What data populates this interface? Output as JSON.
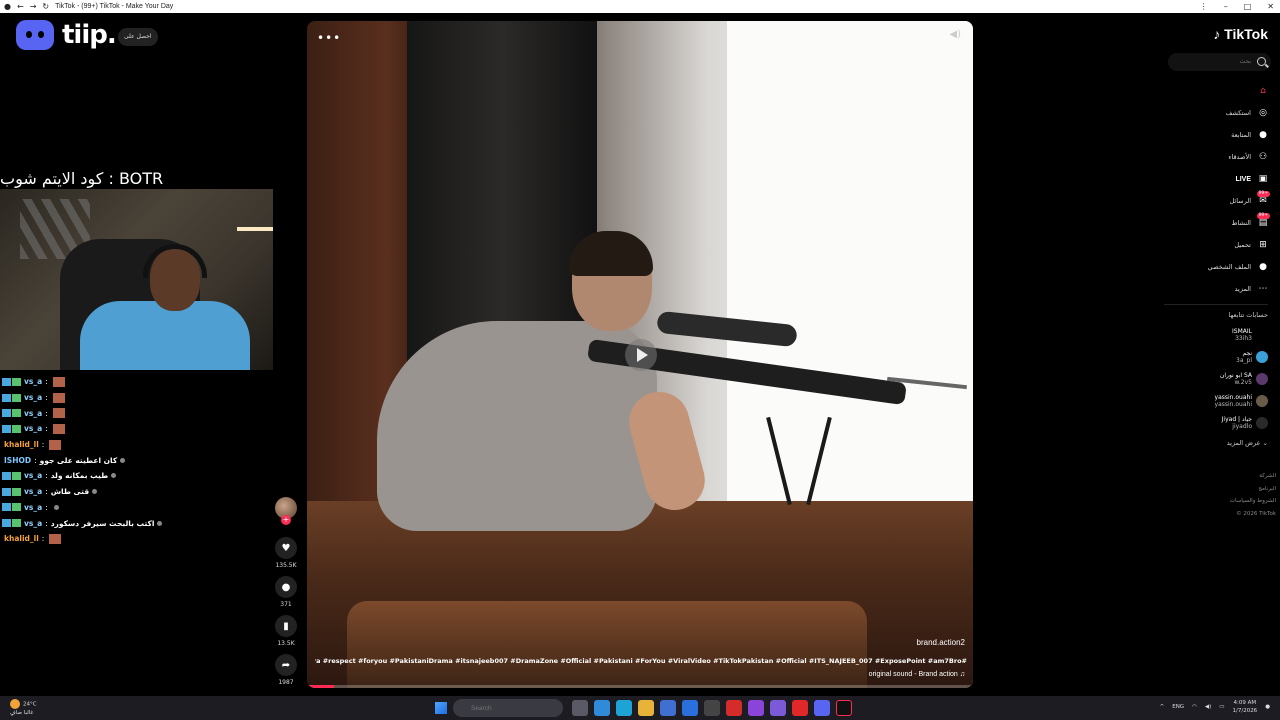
{
  "browser": {
    "tab_title": "TikTok - (99+) TikTok - Make Your Day",
    "nav_icons": [
      "back-icon",
      "forward-icon",
      "reload-icon"
    ]
  },
  "overlay": {
    "tiip_label": "tiip.",
    "get_pill": "احصل على",
    "item_code": "كود الايتم شوب : BOTR"
  },
  "chat": [
    {
      "user": "vs_a",
      "color": "blue",
      "badges": true,
      "message": "",
      "emote": true
    },
    {
      "user": "vs_a",
      "color": "blue",
      "badges": true,
      "message": "",
      "emote": true
    },
    {
      "user": "vs_a",
      "color": "blue",
      "badges": true,
      "message": "",
      "emote": true
    },
    {
      "user": "vs_a",
      "color": "blue",
      "badges": true,
      "message": "",
      "emote": true
    },
    {
      "user": "khalid_ll",
      "color": "orange",
      "badges": false,
      "message": "",
      "emote": true
    },
    {
      "user": "ISHOD",
      "color": "cyan",
      "badges": false,
      "message": "كان اعطيته على جوو",
      "emote": false
    },
    {
      "user": "vs_a",
      "color": "blue",
      "badges": true,
      "message": "طيب بمكانه ولد",
      "emote": false
    },
    {
      "user": "vs_a",
      "color": "blue",
      "badges": true,
      "message": "قتى طاش",
      "emote": false
    },
    {
      "user": "vs_a",
      "color": "blue",
      "badges": true,
      "message": "",
      "emote": false
    },
    {
      "user": "vs_a",
      "color": "blue",
      "badges": true,
      "message": "اكتب بالبحث سيرفر دسكورد",
      "emote": false
    },
    {
      "user": "khalid_ll",
      "color": "orange",
      "badges": false,
      "message": "",
      "emote": true
    }
  ],
  "actions": {
    "likes": "135.5K",
    "comments": "371",
    "saves": "13.5K",
    "shares": "1987"
  },
  "video": {
    "watermark": "brand.action2",
    "caption": "#edit #aura #respect #foryou #PakistaniDrama #itsnajeeb007 #DramaZone #Official #Pakistani #ForYou #ViralVideo #TikTokPakistan #Official #ITS_NAJEEB_007 #ExposePoint #am7Bro... المزيد",
    "sound": "original sound - Brand action",
    "progress": 0.04
  },
  "sidebar": {
    "logo": "TikTok",
    "search_placeholder": "بحث",
    "nav": [
      {
        "label": "",
        "icon": "home-icon",
        "active": true,
        "badge": ""
      },
      {
        "label": "استكشف",
        "icon": "compass-icon",
        "active": false,
        "badge": ""
      },
      {
        "label": "المتابعة",
        "icon": "following-avatar-icon",
        "active": false,
        "badge": ""
      },
      {
        "label": "الأصدقاء",
        "icon": "friends-icon",
        "active": false,
        "badge": ""
      },
      {
        "label": "LIVE",
        "icon": "live-icon",
        "active": false,
        "badge": ""
      },
      {
        "label": "الرسائل",
        "icon": "messages-icon",
        "active": false,
        "badge": "99+"
      },
      {
        "label": "النشاط",
        "icon": "activity-icon",
        "active": false,
        "badge": "99+"
      },
      {
        "label": "تحميل",
        "icon": "upload-icon",
        "active": false,
        "badge": ""
      },
      {
        "label": "الملف الشخصي",
        "icon": "profile-icon",
        "active": false,
        "badge": ""
      },
      {
        "label": "المزيد",
        "icon": "more-icon",
        "active": false,
        "badge": ""
      }
    ],
    "following_title": "حسابات تتابعها",
    "following": [
      {
        "name": "ISMAIL",
        "handle": "33ih3"
      },
      {
        "name": "نجم",
        "handle": "3a_pl"
      },
      {
        "name": "ابو نوران SA",
        "handle": "w.2v5"
      },
      {
        "name": "yassin.ouahi",
        "handle": "yassin.ouahi"
      },
      {
        "name": "Jiyad | جياد",
        "handle": "jiyadlo"
      }
    ],
    "see_more": "عرض المزيد",
    "footer": [
      "الشركة",
      "البرنامج",
      "الشروط والسياسات",
      "© 2026 TikTok"
    ]
  },
  "taskbar": {
    "weather_temp": "24°C",
    "weather_desc": "غالبا صافٍ",
    "search_placeholder": "Search",
    "lang": "ENG",
    "time": "4:09 AM",
    "date": "1/7/2026"
  }
}
